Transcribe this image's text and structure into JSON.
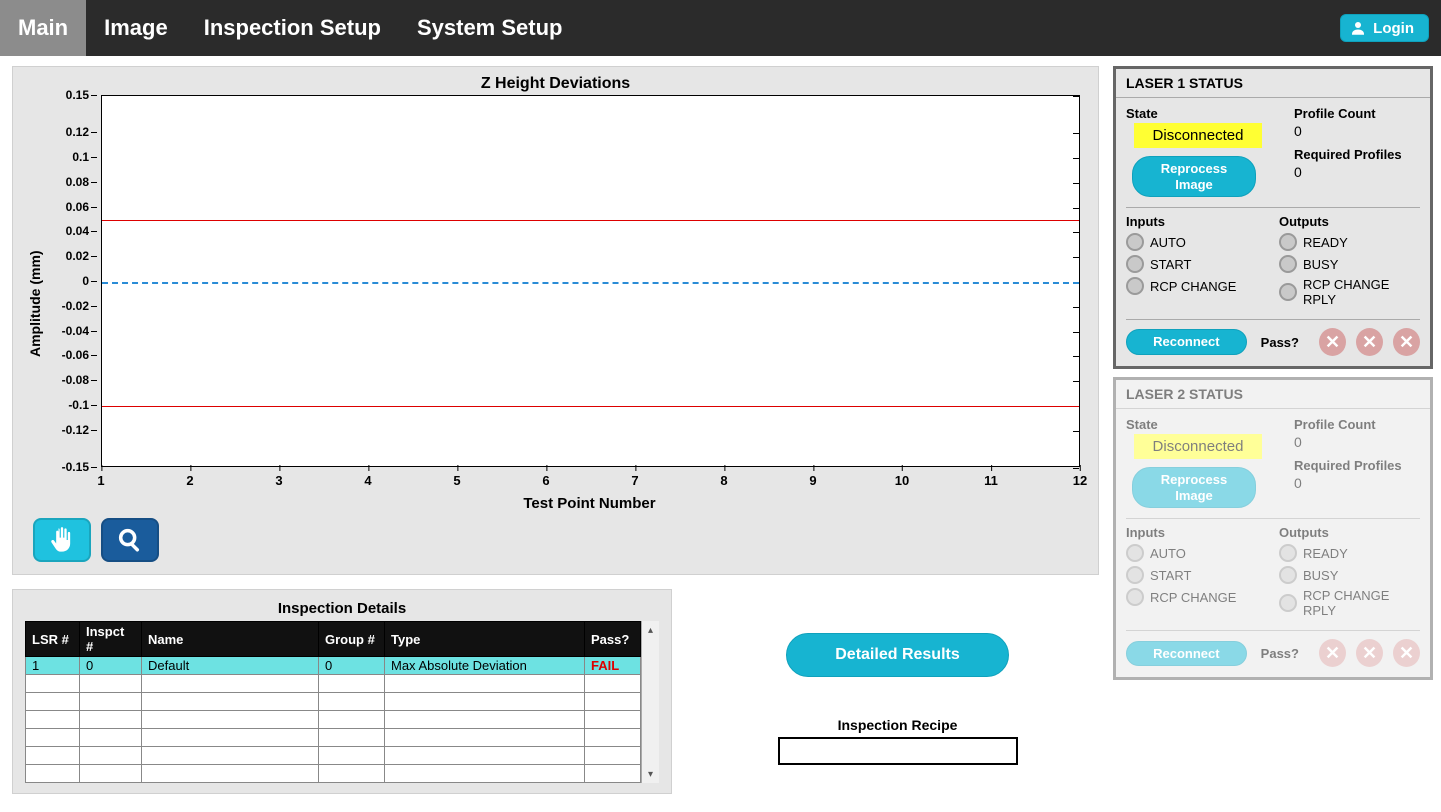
{
  "nav": {
    "tabs": [
      "Main",
      "Image",
      "Inspection Setup",
      "System Setup"
    ],
    "active": 0,
    "login": "Login"
  },
  "chart_data": {
    "type": "line",
    "title": "Z Height Deviations",
    "xlabel": "Test Point Number",
    "ylabel": "Amplitude (mm)",
    "x_ticks": [
      "1",
      "2",
      "3",
      "4",
      "5",
      "6",
      "7",
      "8",
      "9",
      "10",
      "11",
      "12"
    ],
    "y_ticks": [
      "0.15",
      "0.12",
      "0.1",
      "0.08",
      "0.06",
      "0.04",
      "0.02",
      "0",
      "-0.02",
      "-0.04",
      "-0.06",
      "-0.08",
      "-0.1",
      "-0.12",
      "-0.15"
    ],
    "ylim": [
      -0.15,
      0.15
    ],
    "xlim": [
      1,
      12
    ],
    "ref_lines": [
      {
        "y": 0.05,
        "style": "red"
      },
      {
        "y": 0.0,
        "style": "blue-dash"
      },
      {
        "y": -0.1,
        "style": "red"
      }
    ],
    "series": []
  },
  "tools": {
    "pan": "pan-icon",
    "zoom": "zoom-icon"
  },
  "details": {
    "title": "Inspection Details",
    "headers": [
      "LSR #",
      "Inspct #",
      "Name",
      "Group #",
      "Type",
      "Pass?"
    ],
    "rows": [
      {
        "lsr": "1",
        "inspct": "0",
        "name": "Default",
        "group": "0",
        "type": "Max Absolute Deviation",
        "pass": "FAIL"
      }
    ]
  },
  "results": {
    "detailed_btn": "Detailed Results",
    "recipe_label": "Inspection Recipe",
    "recipe_value": ""
  },
  "laser1": {
    "header": "LASER 1 STATUS",
    "state_label": "State",
    "state_value": "Disconnected",
    "reprocess": "Reprocess Image",
    "profile_count_label": "Profile Count",
    "profile_count_value": "0",
    "required_label": "Required Profiles",
    "required_value": "0",
    "inputs_label": "Inputs",
    "outputs_label": "Outputs",
    "inputs": [
      "AUTO",
      "START",
      "RCP CHANGE"
    ],
    "outputs": [
      "READY",
      "BUSY",
      "RCP CHANGE RPLY"
    ],
    "reconnect": "Reconnect",
    "pass_label": "Pass?"
  },
  "laser2": {
    "header": "LASER 2 STATUS",
    "state_label": "State",
    "state_value": "Disconnected",
    "reprocess": "Reprocess Image",
    "profile_count_label": "Profile Count",
    "profile_count_value": "0",
    "required_label": "Required Profiles",
    "required_value": "0",
    "inputs_label": "Inputs",
    "outputs_label": "Outputs",
    "inputs": [
      "AUTO",
      "START",
      "RCP CHANGE"
    ],
    "outputs": [
      "READY",
      "BUSY",
      "RCP CHANGE RPLY"
    ],
    "reconnect": "Reconnect",
    "pass_label": "Pass?"
  }
}
